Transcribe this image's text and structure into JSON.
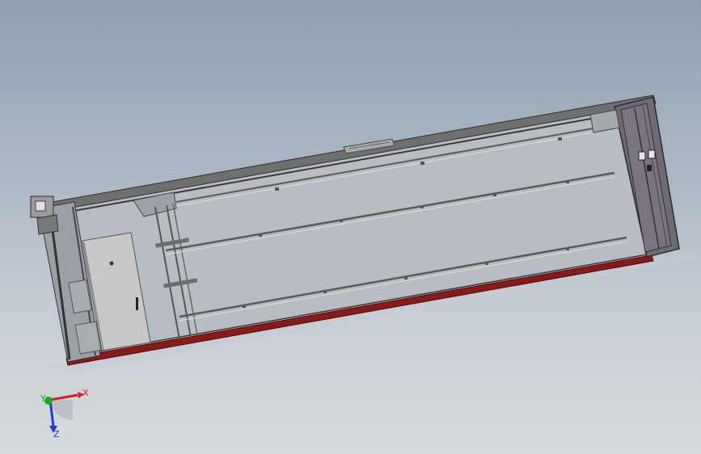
{
  "viewport": {
    "background_top": "#8f9fb2",
    "background_bottom": "#d7dadd"
  },
  "model": {
    "frame_color": "#3a3a3a",
    "panel_color": "#b9bec4",
    "door_color": "#c8c8c8",
    "base_color": "#8a1a1a",
    "end_panel_color": "#6f6a73"
  },
  "triad": {
    "x_label": "X",
    "y_label": "Y",
    "z_label": "Z",
    "x_color": "#d42020",
    "y_color": "#1fa81f",
    "z_color": "#2040c8"
  }
}
